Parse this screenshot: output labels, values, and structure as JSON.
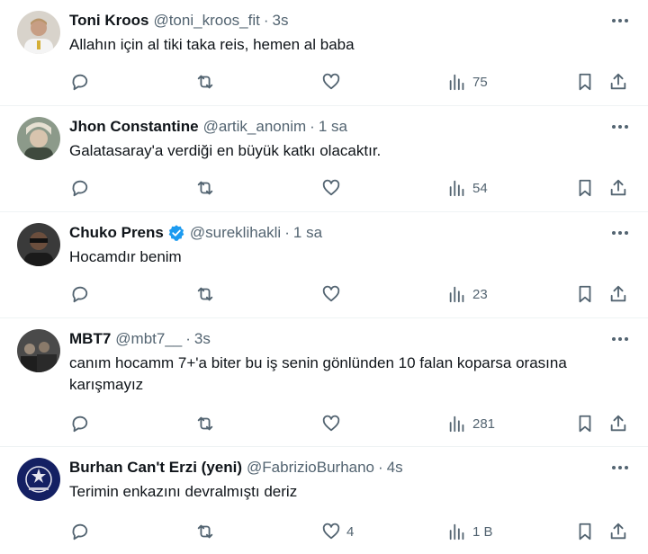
{
  "tweets": [
    {
      "name": "Toni Kroos",
      "handle": "@toni_kroos_fit",
      "separator": "·",
      "time": "3s",
      "text": "Allahın için al tiki taka reis, hemen al baba",
      "verified": false,
      "likes": "",
      "views": "75",
      "avatar_color": "#c9c3b8"
    },
    {
      "name": "Jhon Constantine",
      "handle": "@artik_anonim",
      "separator": "·",
      "time": "1 sa",
      "text": "Galatasaray'a verdiği en büyük katkı olacaktır.",
      "verified": false,
      "likes": "",
      "views": "54",
      "avatar_color": "#6d7a6a"
    },
    {
      "name": "Chuko Prens",
      "handle": "@sureklihakli",
      "separator": "·",
      "time": "1 sa",
      "text": "Hocamdır benim",
      "verified": true,
      "likes": "",
      "views": "23",
      "avatar_color": "#2b2b2b"
    },
    {
      "name": "MBT7",
      "handle": "@mbt7__",
      "separator": "·",
      "time": "3s",
      "text": "canım hocamm 7+'a biter bu iş senin gönlünden 10 falan koparsa orasına karışmayız",
      "verified": false,
      "likes": "",
      "views": "281",
      "avatar_color": "#3a3a3a"
    },
    {
      "name": "Burhan Can't Erzi (yeni)",
      "handle": "@FabrizioBurhano",
      "separator": "·",
      "time": "4s",
      "text": "Terimin enkazını devralmıştı deriz",
      "verified": false,
      "likes": "4",
      "views": "1 B",
      "avatar_color": "#1b2a6b"
    }
  ],
  "colors": {
    "text": "#0f1419",
    "secondary": "#536471",
    "verified": "#1d9bf0",
    "divider": "#eff3f4"
  },
  "icons": [
    "reply-icon",
    "retweet-icon",
    "like-icon",
    "views-icon",
    "bookmark-icon",
    "share-icon",
    "more-icon",
    "verified-badge-icon"
  ]
}
